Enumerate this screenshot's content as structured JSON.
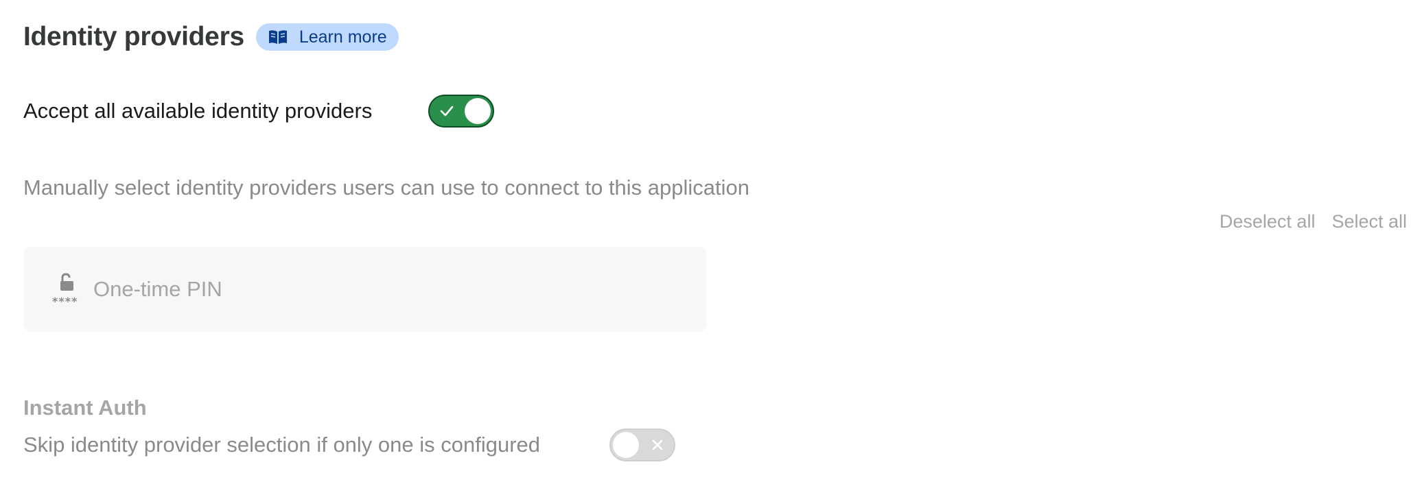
{
  "header": {
    "title": "Identity providers",
    "learn_more_label": "Learn more"
  },
  "accept_all": {
    "label": "Accept all available identity providers",
    "enabled": true
  },
  "manual_select": {
    "description": "Manually select identity providers users can use to connect to this application",
    "deselect_all_label": "Deselect all",
    "select_all_label": "Select all"
  },
  "providers": [
    {
      "name": "One-time PIN",
      "icon": "unlock-icon",
      "icon_caption": "****"
    }
  ],
  "instant_auth": {
    "title": "Instant Auth",
    "label": "Skip identity provider selection if only one is configured",
    "enabled": false
  },
  "colors": {
    "toggle_on": "#2a8f4a",
    "learn_more_bg": "#bfd9ff",
    "learn_more_text": "#0a3c8c"
  }
}
